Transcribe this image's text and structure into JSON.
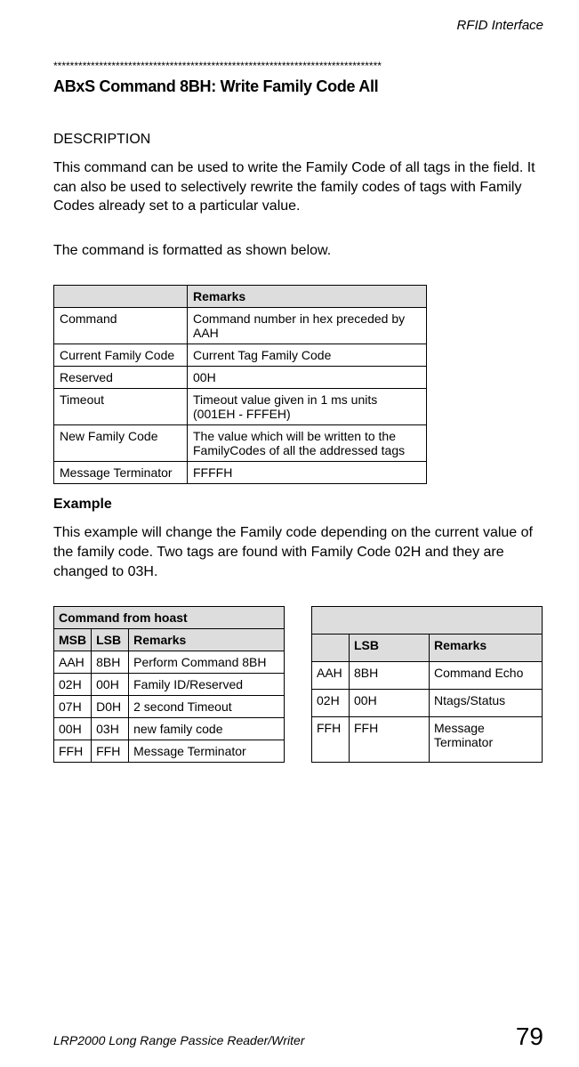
{
  "header": {
    "right": "RFID Interface"
  },
  "stars": "*******************************************************************************",
  "title": "ABxS Command 8BH: Write Family Code All",
  "desc_heading": "DESCRIPTION",
  "desc_body": "This command can be used to write the Family Code of all tags in the field. It can also be used to selectively rewrite the family codes of tags with Family Codes already set to a particular value.",
  "format_intro": "The command is formatted as shown below.",
  "format_table": {
    "header": [
      "",
      "Remarks"
    ],
    "rows": [
      [
        "Command",
        "Command number in hex preceded by AAH"
      ],
      [
        "Current Family Code",
        "Current Tag Family Code"
      ],
      [
        "Reserved",
        "00H"
      ],
      [
        "Timeout",
        "Timeout value given in 1 ms units (001EH - FFFEH)"
      ],
      [
        "New Family Code",
        "The value which will be written to the FamilyCodes of all the addressed tags"
      ],
      [
        "Message Terminator",
        "FFFFH"
      ]
    ]
  },
  "example_heading": "Example",
  "example_body": "This example will change the Family code depending on the current value of the family code. Two tags are found with Family Code 02H and they are changed to 03H.",
  "cmd_table": {
    "caption": "Command from hoast",
    "headers": [
      "MSB",
      "LSB",
      "Remarks"
    ],
    "rows": [
      [
        "AAH",
        "8BH",
        "Perform Command 8BH"
      ],
      [
        "02H",
        "00H",
        "Family ID/Reserved"
      ],
      [
        "07H",
        "D0H",
        "2 second Timeout"
      ],
      [
        "00H",
        "03H",
        "new family code"
      ],
      [
        "FFH",
        "FFH",
        "Message Terminator"
      ]
    ]
  },
  "resp_table": {
    "headers": [
      "",
      "LSB",
      "Remarks"
    ],
    "rows": [
      [
        "AAH",
        "8BH",
        "Command Echo"
      ],
      [
        "02H",
        "00H",
        "Ntags/Status"
      ],
      [
        "FFH",
        "FFH",
        "Message Terminator"
      ]
    ]
  },
  "footer": {
    "left": "LRP2000 Long Range Passice Reader/Writer",
    "right": "79"
  }
}
